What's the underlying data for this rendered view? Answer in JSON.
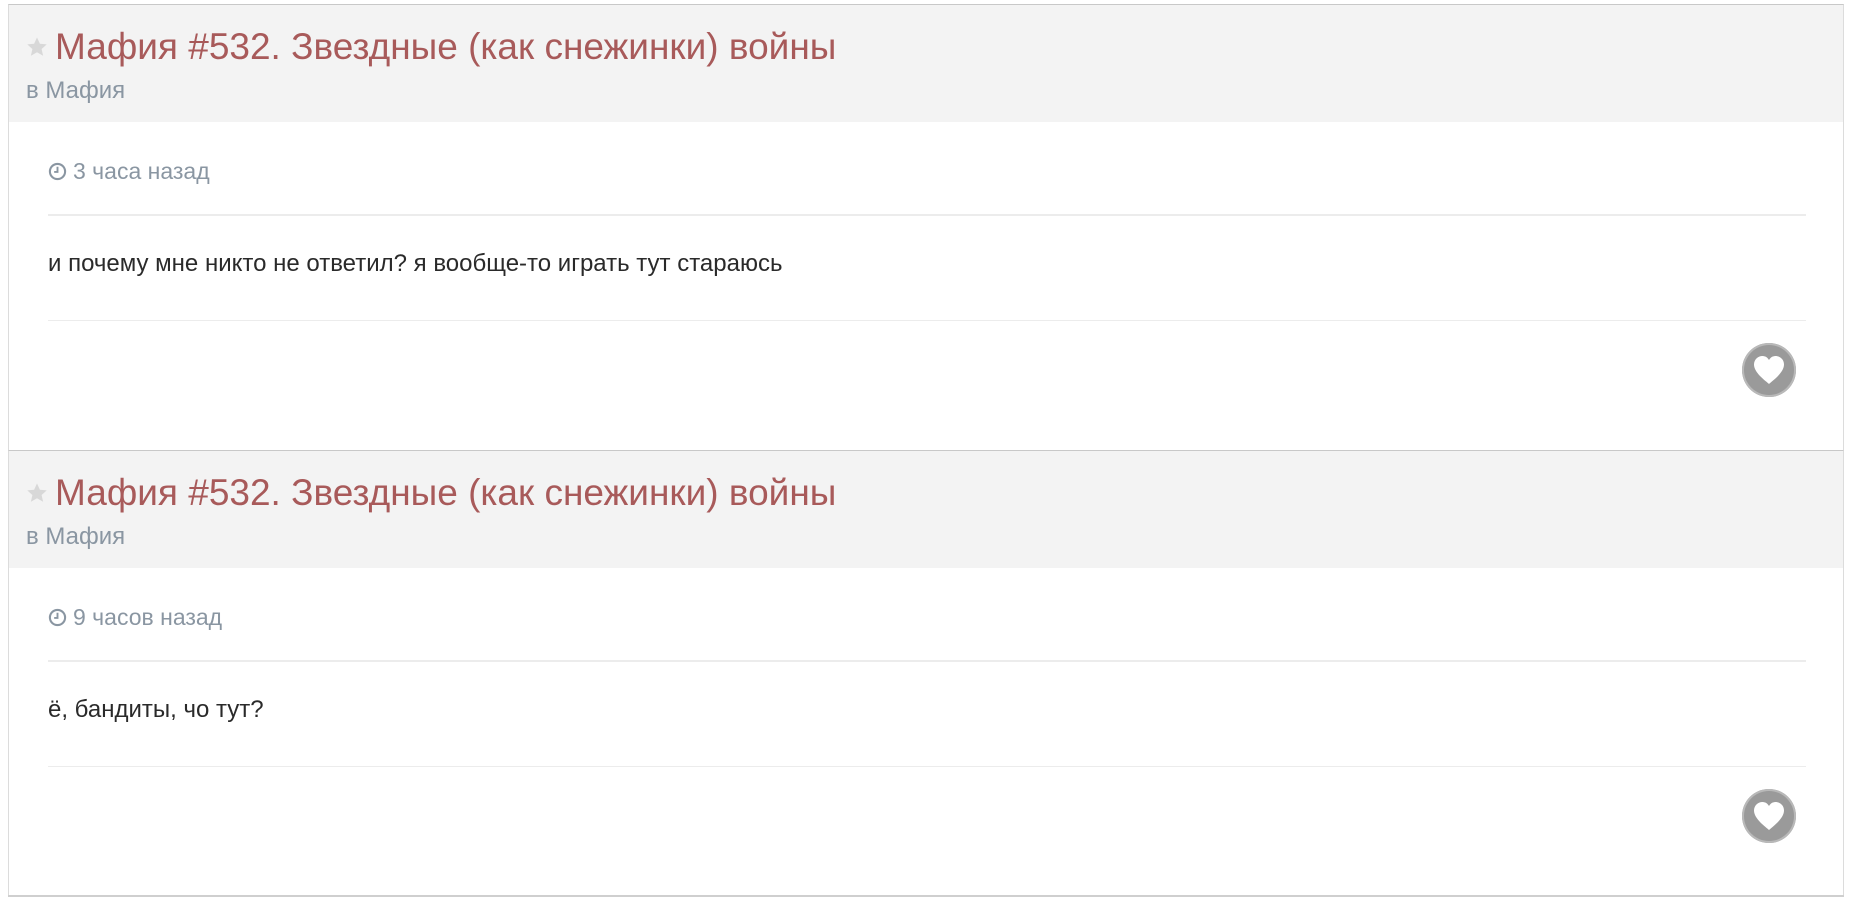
{
  "posts": [
    {
      "title": "Мафия #532. Звездные (как снежинки) войны",
      "forum_prefix": "в",
      "forum": "Мафия",
      "time": "3 часа назад",
      "content": "и почему мне никто не ответил? я вообще-то играть тут стараюсь"
    },
    {
      "title": "Мафия #532. Звездные (как снежинки) войны",
      "forum_prefix": "в",
      "forum": "Мафия",
      "time": "9 часов назад",
      "content": "ё, бандиты, чо тут?"
    }
  ],
  "icons": {
    "star": "star-icon",
    "clock": "clock-icon",
    "like": "heart-icon"
  },
  "colors": {
    "title": "#a85a5a",
    "meta": "#8a96a2",
    "header_bg": "#f3f3f3",
    "like_bg": "#9a9a9a"
  }
}
